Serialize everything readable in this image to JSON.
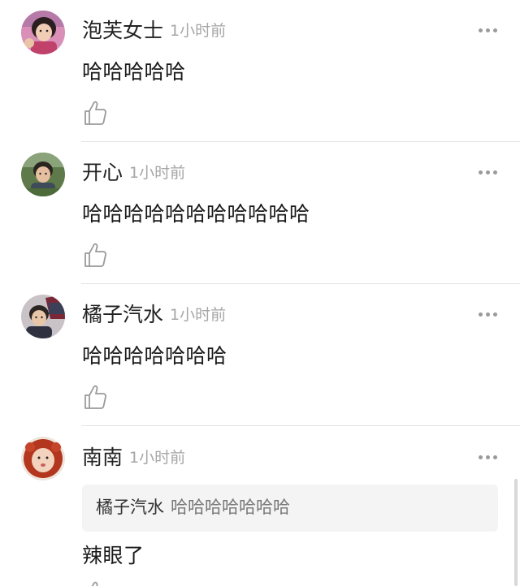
{
  "comments": [
    {
      "username": "泡芙女士",
      "timestamp": "1小时前",
      "text": "哈哈哈哈哈",
      "avatar_icon": "girl-avatar-icon"
    },
    {
      "username": "开心",
      "timestamp": "1小时前",
      "text": "哈哈哈哈哈哈哈哈哈哈哈",
      "avatar_icon": "boy-avatar-icon"
    },
    {
      "username": "橘子汽水",
      "timestamp": "1小时前",
      "text": "哈哈哈哈哈哈哈",
      "avatar_icon": "boy-car-avatar-icon"
    },
    {
      "username": "南南",
      "timestamp": "1小时前",
      "text": "辣眼了",
      "avatar_icon": "lion-costume-avatar-icon",
      "quote": {
        "username": "橘子汽水",
        "text": "哈哈哈哈哈哈哈"
      }
    }
  ],
  "icons": {
    "like": "thumbs-up-icon",
    "more": "more-dots-icon"
  },
  "colors": {
    "username": "#222222",
    "timestamp": "#a6a6a6",
    "divider": "#e3e3e3",
    "quote_bg": "#f4f4f4"
  }
}
